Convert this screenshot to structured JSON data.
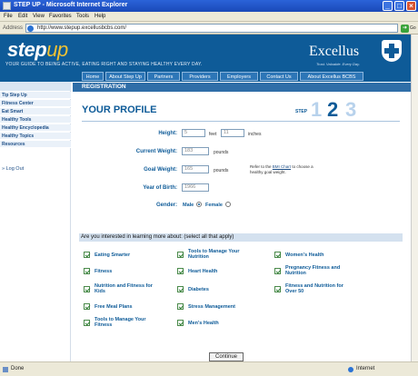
{
  "window": {
    "title": "STEP UP - Microsoft Internet Explorer",
    "minimize": "_",
    "maximize": "□",
    "close": "×"
  },
  "menu": [
    "File",
    "Edit",
    "View",
    "Favorites",
    "Tools",
    "Help"
  ],
  "address": {
    "label": "Address",
    "url": "http://www.stepup.excellusbcbs.com/",
    "go": "Go"
  },
  "banner": {
    "logo_main": "step",
    "logo_accent": "up",
    "tagline": "YOUR GUIDE TO BEING ACTIVE, EATING RIGHT AND STAYING HEALTHY EVERY DAY.",
    "brand": "Excellus",
    "brand_tag": "Trust. Valuable. Every Day."
  },
  "nav_tabs": [
    "Home",
    "About Step Up",
    "Partners",
    "Providers",
    "Employers",
    "Contact Us",
    "About Excellus BCBS"
  ],
  "sidebar": {
    "items": [
      "Tip Step Up",
      "Fitness Center",
      "Eat Smart",
      "Healthy Tools",
      "Healthy Encyclopedia",
      "Healthy Topics",
      "Resources"
    ],
    "logout": "» Log Out"
  },
  "registration_label": "REGISTRATION",
  "profile": {
    "title": "YOUR PROFILE",
    "step_label": "STEP",
    "steps": [
      "1",
      "2",
      "3"
    ],
    "accent_colors": {
      "inactive": "#b8d2ec",
      "active": "#0e5b98"
    }
  },
  "form": {
    "height_label": "Height:",
    "height_feet": "5",
    "height_feet_unit": "feet",
    "height_inches": "11",
    "height_inches_unit": "inches",
    "current_weight_label": "Current Weight:",
    "current_weight": "183",
    "current_weight_unit": "pounds",
    "goal_weight_label": "Goal Weight:",
    "goal_weight": "165",
    "goal_weight_unit": "pounds",
    "goal_note_pre": "Refer to the",
    "goal_note_link": "BMI Chart",
    "goal_note_post": "to choose a healthy goal weight.",
    "birth_year_label": "Year of Birth:",
    "birth_year": "1966",
    "gender_label": "Gender:",
    "gender_male": "Male",
    "gender_female": "Female",
    "gender_selected": "Male"
  },
  "interests": {
    "prompt": "Are you interested in learning more about: (select all that apply)",
    "items": [
      "Eating Smarter",
      "Tools to Manage Your Nutrition",
      "Women's Health",
      "Fitness",
      "Heart Health",
      "Pregnancy Fitness and Nutrition",
      "Nutrition and Fitness for Kids",
      "Diabetes",
      "Fitness and Nutrition for Over 50",
      "Free Meal Plans",
      "Stress Management",
      "",
      "Tools to Manage Your Fitness",
      "Men's Health",
      ""
    ]
  },
  "continue_label": "Continue",
  "status": {
    "text": "Done",
    "zone": "Internet"
  }
}
